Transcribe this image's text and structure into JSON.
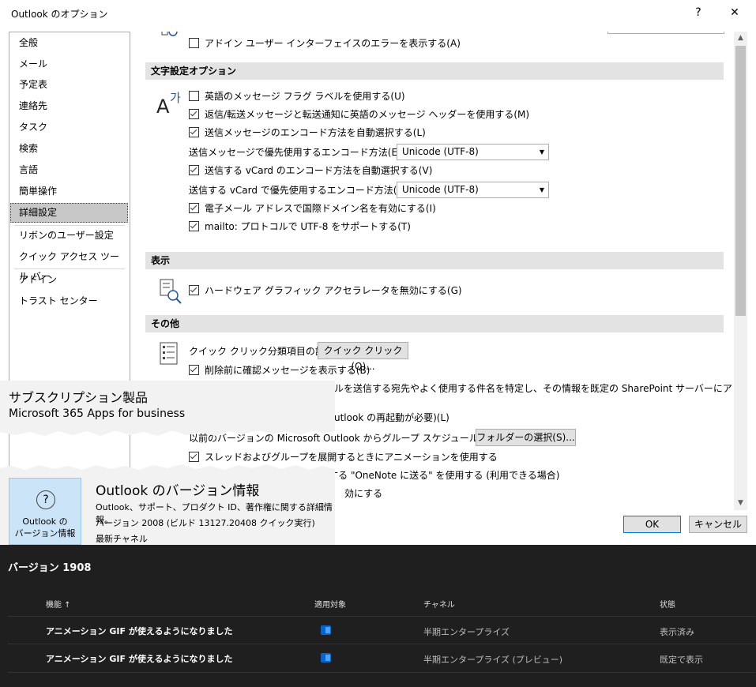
{
  "window": {
    "title": "Outlook のオプション",
    "help": "?",
    "close": "✕"
  },
  "nav": {
    "items": [
      "全般",
      "メール",
      "予定表",
      "連絡先",
      "タスク",
      "検索",
      "言語",
      "簡単操作",
      "詳細設定",
      "リボンのユーザー設定",
      "クイック アクセス ツール バー",
      "アドイン",
      "トラスト センター"
    ],
    "selected": "詳細設定"
  },
  "content": {
    "addin_error": "アドイン ユーザー インターフェイスのエラーを表示する(A)",
    "sec_text": "文字設定オプション",
    "opt_english_flags": "英語のメッセージ フラグ ラベルを使用する(U)",
    "opt_english_headers": "返信/転送メッセージと転送通知に英語のメッセージ ヘッダーを使用する(M)",
    "opt_auto_encode": "送信メッセージのエンコード方法を自動選択する(L)",
    "label_pref_encode": "送信メッセージで優先使用するエンコード方法(E):",
    "pref_encode_value": "Unicode (UTF-8)",
    "opt_vcard_auto": "送信する vCard のエンコード方法を自動選択する(V)",
    "label_vcard_encode": "送信する vCard で優先使用するエンコード方法(R):",
    "vcard_encode_value": "Unicode (UTF-8)",
    "opt_idn": "電子メール アドレスで国際ドメイン名を有効にする(I)",
    "opt_mailto": "mailto: プロトコルで UTF-8 をサポートする(T)",
    "sec_display": "表示",
    "opt_hw_accel": "ハードウェア グラフィック アクセラレータを無効にする(G)",
    "sec_other": "その他",
    "label_quick_click": "クイック クリック分類項目の設定:",
    "btn_quick_click": "クイック クリック(Q)...",
    "opt_confirm_delete": "削除前に確認メッセージを表示する(B)",
    "frag_sharepoint": "ルを送信する宛先やよく使用する件名を特定し、その情報を既定の SharePoint サーバーにアップロード",
    "frag_restart": "utlook の再起動が必要)(L)",
    "label_migrate": "以前のバージョンの Microsoft Outlook からグループ スケジュールを移行:",
    "btn_folder": "フォルダーの選択(S)...",
    "opt_animation": "スレッドおよびグループを展開するときにアニメーションを使用する",
    "frag_onenote": "No      対する \"OneNote に送る\" を使用する (利用できる場合)",
    "frag_enable": "効にする"
  },
  "footer": {
    "ok": "OK",
    "cancel": "キャンセル"
  },
  "subscription": {
    "heading": "サブスクリプション製品",
    "product": "Microsoft 365 Apps for business"
  },
  "about": {
    "button_line1": "Outlook の",
    "button_line2": "バージョン情報",
    "title": "Outlook のバージョン情報",
    "desc": "Outlook、サポート、プロダクト ID、著作権に関する詳細情報。",
    "version": "バージョン 2008 (ビルド 13127.20408 クイック実行)",
    "channel": "最新チャネル"
  },
  "table": {
    "title": "バージョン 1908",
    "headers": {
      "feature": "機能 ↑",
      "applies": "適用対象",
      "channel": "チャネル",
      "status": "状態"
    },
    "rows": [
      {
        "feature": "アニメーション GIF が使えるようになりました",
        "channel": "半期エンタープライズ",
        "status": "表示済み"
      },
      {
        "feature": "アニメーション GIF が使えるようになりました",
        "channel": "半期エンタープライズ (プレビュー)",
        "status": "既定で表示"
      }
    ]
  }
}
